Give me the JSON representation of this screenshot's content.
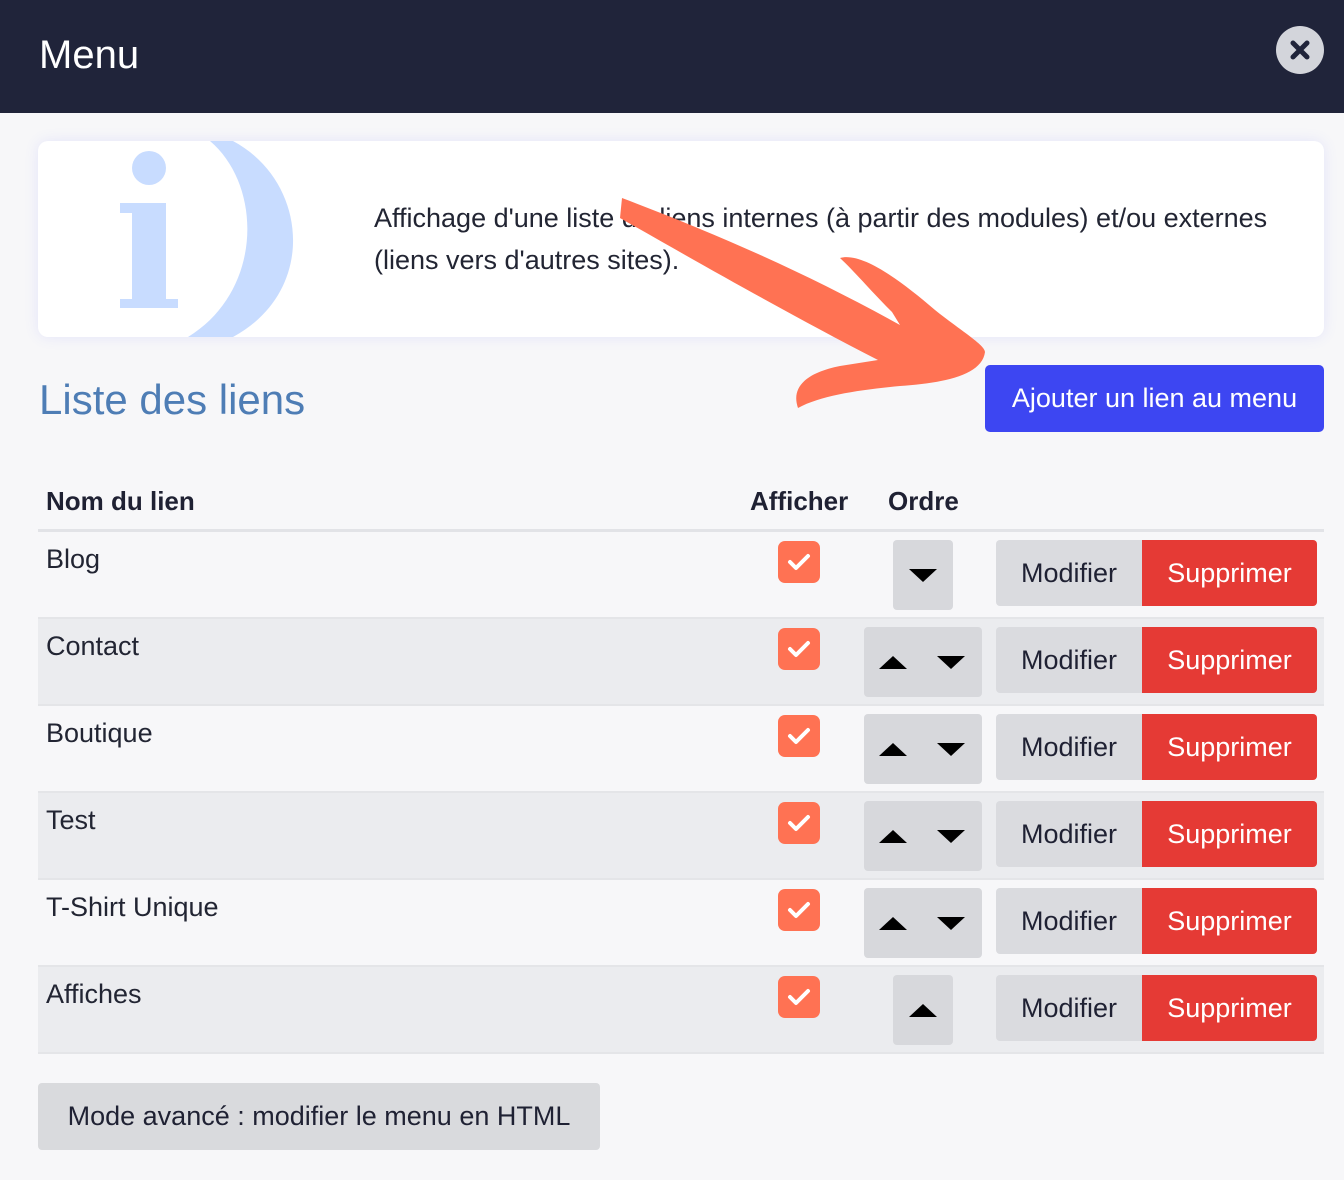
{
  "window": {
    "title": "Menu",
    "close_icon": "close-icon"
  },
  "info": {
    "icon": "info-icon",
    "text": "Affichage d'une liste de liens internes (à partir des modules) et/ou externes (liens vers d'autres sites)."
  },
  "section": {
    "title": "Liste des liens",
    "add_label": "Ajouter un lien au menu"
  },
  "table": {
    "headers": {
      "name": "Nom du lien",
      "show": "Afficher",
      "order": "Ordre"
    },
    "rows": [
      {
        "label": "Blog",
        "checked": true
      },
      {
        "label": "Contact",
        "checked": true
      },
      {
        "label": "Boutique",
        "checked": true
      },
      {
        "label": "Test",
        "checked": true
      },
      {
        "label": "T-Shirt Unique",
        "checked": true
      },
      {
        "label": "Affiches",
        "checked": true
      }
    ],
    "modify_label": "Modifier",
    "delete_label": "Supprimer"
  },
  "advanced_label": "Mode avancé : modifier le menu en HTML",
  "colors": {
    "header_bg": "#20243a",
    "accent": "#3d46f2",
    "danger": "#e53a35",
    "check": "#ff7253",
    "title": "#4e7db5",
    "annotation_arrow": "#ff7253"
  }
}
